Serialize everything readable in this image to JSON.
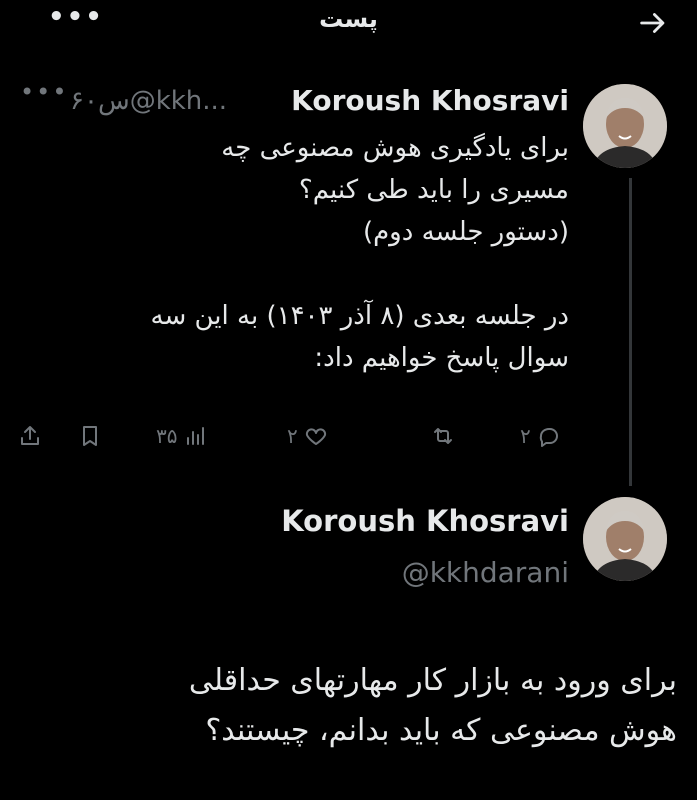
{
  "header": {
    "title": "پست",
    "back_icon": "arrow-right-icon",
    "more_icon": "more-horizontal-icon",
    "more_glyph": "•••"
  },
  "tweet1": {
    "author": "Koroush Khosravi",
    "handle_time": "۶۰س@kkh...",
    "more_glyph": "•••",
    "body": "برای یادگیری هوش مصنوعی چه\nمسیری را باید طی کنیم؟\n(دستور جلسه دوم)\n\nدر جلسه بعدی (۸ آذر ۱۴۰۳) به این سه\nسوال پاسخ خواهیم داد:",
    "actions": {
      "replies": "۲",
      "retweets": "",
      "likes": "۲",
      "views": "۳۵"
    }
  },
  "tweet2": {
    "author": "Koroush Khosravi",
    "handle": "@kkhdarani",
    "body": "برای ورود به بازار کار مهارتهای حداقلی\nهوش مصنوعی که باید بدانم، چیستند؟"
  },
  "colors": {
    "background": "#000000",
    "text": "#e7e9ea",
    "muted": "#71767b",
    "thread_line": "#333639"
  }
}
